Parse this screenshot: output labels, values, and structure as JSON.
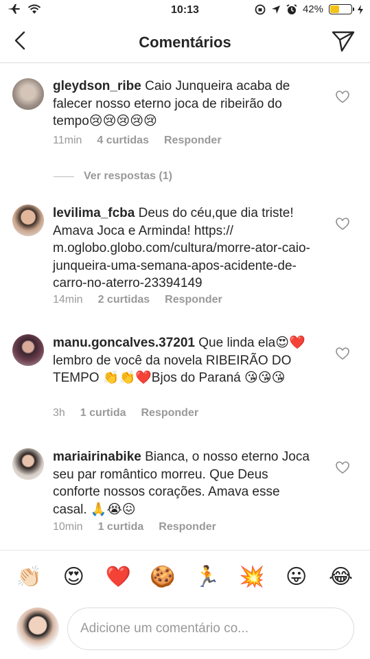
{
  "status_bar": {
    "time": "10:13",
    "battery": "42%",
    "battery_level": 0.42
  },
  "header": {
    "title": "Comentários"
  },
  "comments": [
    {
      "username": "gleydson_ribe",
      "text": "Caio Junqueira acaba de falecer nosso eterno joca de ribeirão do tempo😢😢😢😢😢",
      "time": "11min",
      "likes": "4 curtidas",
      "reply": "Responder"
    },
    {
      "username": "levilima_fcba",
      "text": "Deus do céu,que dia triste! Amava Joca e Arminda! https:// m.oglobo.globo.com/cultura/morre-ator-caio-junqueira-uma-semana-apos-acidente-de-carro-no-aterro-23394149",
      "time": "14min",
      "likes": "2 curtidas",
      "reply": "Responder"
    },
    {
      "username": "manu.goncalves.37201",
      "text": "Que linda ela😍❤️ lembro de você  da novela RIBEIRÃO DO TEMPO 👏👏❤️Bjos do Paraná 😘😘😘",
      "time": "3h",
      "likes": "1 curtida",
      "reply": "Responder"
    },
    {
      "username": "mariairinabike",
      "text": "Bianca, o nosso eterno Joca seu par romântico morreu. Que Deus conforte nossos corações. Amava esse casal. 🙏😭😖",
      "time": "10min",
      "likes": "1 curtida",
      "reply": "Responder"
    }
  ],
  "view_replies": "Ver respostas (1)",
  "emoji_bar": [
    "👏🏻",
    "😍",
    "❤️",
    "🍪",
    "🏃",
    "💥",
    "😛",
    "😂"
  ],
  "composer": {
    "placeholder": "Adicione um comentário co..."
  },
  "colors": {
    "meta": "#999999",
    "text": "#262626",
    "battery": "#f2c21a"
  }
}
